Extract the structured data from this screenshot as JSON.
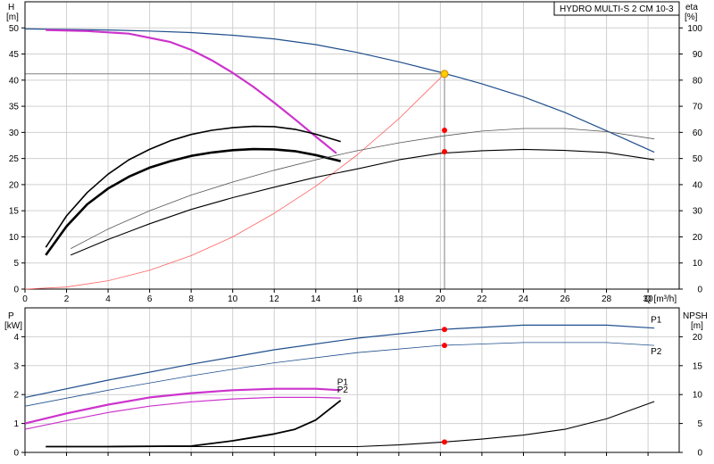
{
  "chart_data": [
    {
      "type": "line",
      "title": "HYDRO MULTI-S 2 CM 10-3",
      "xlabel": "Q [m³/h]",
      "ylabel_left": [
        "H",
        "[m]"
      ],
      "ylabel_right": [
        "eta",
        "[%]"
      ],
      "xlim": [
        0,
        31.5
      ],
      "ylim_left": [
        0,
        55
      ],
      "ylim_right": [
        0,
        110
      ],
      "xticks": [
        0,
        2,
        4,
        6,
        8,
        10,
        12,
        14,
        16,
        18,
        20,
        22,
        24,
        26,
        28,
        30
      ],
      "yticks_left": [
        0,
        5,
        10,
        15,
        20,
        25,
        30,
        35,
        40,
        45,
        50
      ],
      "yticks_right": [
        0,
        10,
        20,
        30,
        40,
        50,
        60,
        70,
        80,
        90,
        100
      ],
      "grid": true,
      "duty_point": {
        "x": 20.2,
        "y": 41.2,
        "color": "#ffcc00"
      },
      "series": [
        {
          "axis": "left",
          "color": "#1f4e8c",
          "width": 1.2,
          "x": [
            0,
            2,
            4,
            6,
            8,
            10,
            12,
            14,
            16,
            18,
            20,
            22,
            24,
            26,
            28,
            30.3
          ],
          "y": [
            49.8,
            49.7,
            49.6,
            49.4,
            49.1,
            48.6,
            47.9,
            46.8,
            45.3,
            43.5,
            41.5,
            39.3,
            36.8,
            33.8,
            30.3,
            26.2
          ]
        },
        {
          "axis": "left",
          "color": "#cc33cc",
          "width": 2.2,
          "x": [
            1,
            3,
            5,
            7,
            8,
            9,
            10,
            11,
            12,
            13,
            14,
            15
          ],
          "y": [
            49.6,
            49.4,
            48.9,
            47.3,
            45.8,
            43.8,
            41.4,
            38.7,
            35.7,
            32.5,
            29.2,
            26.0
          ]
        },
        {
          "axis": "left",
          "color": "#ff6060",
          "width": 0.8,
          "x": [
            0,
            2,
            4,
            6,
            8,
            10,
            12,
            14,
            16,
            18,
            20.2
          ],
          "y": [
            0,
            0.4,
            1.6,
            3.6,
            6.4,
            10.0,
            14.5,
            19.7,
            25.7,
            32.6,
            41.2
          ]
        },
        {
          "axis": "right",
          "color": "#000000",
          "width": 1.6,
          "x": [
            1,
            2,
            3,
            4,
            5,
            6,
            7,
            8,
            9,
            10,
            11,
            12,
            13,
            14,
            15.2
          ],
          "y": [
            16,
            28,
            37,
            44,
            49.5,
            53.5,
            56.8,
            59.2,
            60.8,
            61.8,
            62.3,
            62.2,
            61.2,
            59.3,
            56.5
          ]
        },
        {
          "axis": "right",
          "color": "#000000",
          "width": 2.6,
          "x": [
            1,
            2,
            3,
            4,
            5,
            6,
            7,
            8,
            9,
            10,
            11,
            12,
            13,
            14,
            15.2
          ],
          "y": [
            13,
            24,
            32.5,
            38.5,
            43,
            46.5,
            49,
            51,
            52.3,
            53.2,
            53.6,
            53.5,
            52.8,
            51.3,
            49
          ]
        },
        {
          "axis": "right",
          "color": "#555555",
          "width": 0.8,
          "x": [
            2.2,
            4,
            6,
            8,
            10,
            12,
            14,
            16,
            18,
            20,
            22,
            24,
            26,
            28,
            30.3
          ],
          "y": [
            15.5,
            23,
            30,
            36,
            41,
            45.5,
            49.5,
            53,
            56,
            58.5,
            60.5,
            61.5,
            61.5,
            60.3,
            57.5
          ]
        },
        {
          "axis": "right",
          "color": "#000000",
          "width": 1.1,
          "x": [
            2.2,
            4,
            6,
            8,
            10,
            12,
            14,
            16,
            18,
            20,
            22,
            24,
            26,
            28,
            30.3
          ],
          "y": [
            13,
            19,
            25,
            30.5,
            35,
            39,
            42.8,
            46,
            49.5,
            52,
            53,
            53.5,
            53.1,
            52.3,
            49.5
          ]
        }
      ],
      "markers": [
        {
          "x": 20.2,
          "y": 60.8,
          "axis": "right"
        },
        {
          "x": 20.2,
          "y": 52.6,
          "axis": "right"
        }
      ]
    },
    {
      "type": "line",
      "ylabel_left": [
        "P",
        "[kW]"
      ],
      "ylabel_right": [
        "NPSH",
        "[m]"
      ],
      "xlim": [
        0,
        31.5
      ],
      "ylim_left": [
        0,
        5
      ],
      "ylim_right": [
        0,
        25
      ],
      "yticks_left": [
        0,
        1,
        2,
        3,
        4
      ],
      "yticks_right": [
        0,
        5,
        10,
        15,
        20
      ],
      "grid": true,
      "series": [
        {
          "axis": "left",
          "color": "#1f4e8c",
          "width": 1.2,
          "name": "P1",
          "x": [
            0,
            4,
            8,
            12,
            16,
            20,
            24,
            28,
            30.3
          ],
          "y": [
            1.9,
            2.5,
            3.05,
            3.55,
            3.95,
            4.25,
            4.4,
            4.4,
            4.3
          ]
        },
        {
          "axis": "left",
          "color": "#1f4e8c",
          "width": 0.8,
          "name": "P2",
          "x": [
            0,
            4,
            8,
            12,
            16,
            20,
            24,
            28,
            30.3
          ],
          "y": [
            1.6,
            2.15,
            2.65,
            3.1,
            3.45,
            3.7,
            3.8,
            3.8,
            3.7
          ]
        },
        {
          "axis": "left",
          "color": "#cc33cc",
          "width": 2.2,
          "name": "P1",
          "x": [
            0,
            2,
            4,
            6,
            8,
            10,
            12,
            14,
            15.2
          ],
          "y": [
            1.0,
            1.35,
            1.65,
            1.9,
            2.05,
            2.15,
            2.2,
            2.2,
            2.15
          ]
        },
        {
          "axis": "left",
          "color": "#cc33cc",
          "width": 1.2,
          "name": "P2",
          "x": [
            0,
            2,
            4,
            6,
            8,
            10,
            12,
            14,
            15.2
          ],
          "y": [
            0.8,
            1.1,
            1.38,
            1.6,
            1.75,
            1.85,
            1.9,
            1.9,
            1.88
          ]
        },
        {
          "axis": "right",
          "color": "#000000",
          "width": 1.8,
          "x": [
            1,
            4,
            8,
            10,
            11,
            12,
            13,
            14,
            15.2
          ],
          "y": [
            1.0,
            1.0,
            1.1,
            2.0,
            2.6,
            3.2,
            4.0,
            5.6,
            9.0
          ]
        },
        {
          "axis": "right",
          "color": "#000000",
          "width": 1.1,
          "x": [
            1,
            6,
            10,
            16,
            18,
            20.2,
            22,
            24,
            26,
            28,
            30.3
          ],
          "y": [
            1.0,
            1.0,
            1.0,
            1.0,
            1.3,
            1.8,
            2.3,
            3.0,
            4.0,
            5.8,
            8.8
          ]
        }
      ],
      "markers": [
        {
          "x": 20.2,
          "y": 4.25,
          "axis": "left"
        },
        {
          "x": 20.2,
          "y": 3.7,
          "axis": "left"
        },
        {
          "x": 20.2,
          "y": 1.8,
          "axis": "right"
        }
      ]
    }
  ]
}
